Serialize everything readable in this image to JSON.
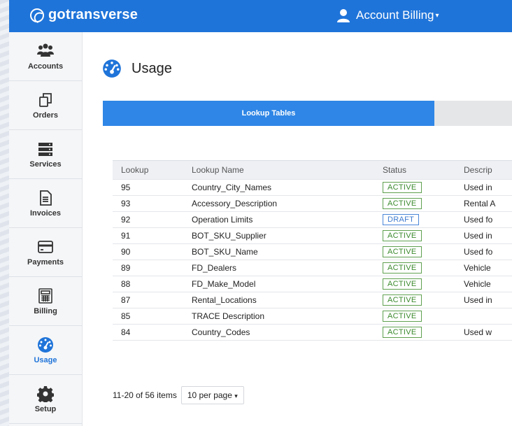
{
  "header": {
    "logo": "gotransverse",
    "account_label": "Account Billing",
    "caret": "▾"
  },
  "sidebar": {
    "items": [
      {
        "label": "Accounts",
        "icon": "users-icon"
      },
      {
        "label": "Orders",
        "icon": "orders-icon"
      },
      {
        "label": "Services",
        "icon": "services-icon"
      },
      {
        "label": "Invoices",
        "icon": "invoice-icon"
      },
      {
        "label": "Payments",
        "icon": "credit-card-icon"
      },
      {
        "label": "Billing",
        "icon": "calculator-icon"
      },
      {
        "label": "Usage",
        "icon": "gauge-icon",
        "active": true
      },
      {
        "label": "Setup",
        "icon": "gear-icon"
      }
    ]
  },
  "page": {
    "title": "Usage"
  },
  "tabs": [
    {
      "label": "Lookup Tables",
      "active": true
    },
    {
      "label": ""
    }
  ],
  "table": {
    "headers": [
      "Lookup",
      "Lookup Name",
      "Status",
      "Descrip"
    ],
    "rows": [
      {
        "id": "95",
        "name": "Country_City_Names",
        "status": "ACTIVE",
        "desc": "Used in"
      },
      {
        "id": "93",
        "name": "Accessory_Description",
        "status": "ACTIVE",
        "desc": "Rental A"
      },
      {
        "id": "92",
        "name": "Operation Limits",
        "status": "DRAFT",
        "desc": "Used fo"
      },
      {
        "id": "91",
        "name": "BOT_SKU_Supplier",
        "status": "ACTIVE",
        "desc": "Used in"
      },
      {
        "id": "90",
        "name": "BOT_SKU_Name",
        "status": "ACTIVE",
        "desc": "Used fo"
      },
      {
        "id": "89",
        "name": "FD_Dealers",
        "status": "ACTIVE",
        "desc": "Vehicle"
      },
      {
        "id": "88",
        "name": "FD_Make_Model",
        "status": "ACTIVE",
        "desc": "Vehicle"
      },
      {
        "id": "87",
        "name": "Rental_Locations",
        "status": "ACTIVE",
        "desc": "Used in"
      },
      {
        "id": "85",
        "name": "TRACE Description",
        "status": "ACTIVE",
        "desc": ""
      },
      {
        "id": "84",
        "name": "Country_Codes",
        "status": "ACTIVE",
        "desc": "Used w"
      }
    ]
  },
  "pager": {
    "summary": "11-20 of 56 items",
    "per_page": "10 per page",
    "caret": "▾"
  },
  "colors": {
    "brand": "#1f74d9",
    "active_tab": "#2f86e6",
    "active_badge": "#3b8a2d",
    "draft_badge": "#3e7bd0"
  }
}
